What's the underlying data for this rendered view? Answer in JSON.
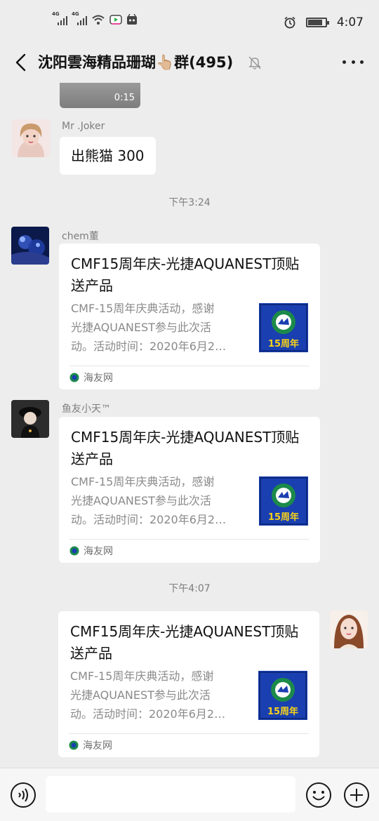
{
  "statusbar": {
    "network1": "4G",
    "network2": "4G",
    "time": "4:07",
    "battery_level": 0.85
  },
  "header": {
    "title": "沈阳雲海精品珊瑚👆🏼群(495)",
    "icons": [
      "back-arrow-icon",
      "mute-bell-icon",
      "more-icon"
    ]
  },
  "chat": {
    "video_duration": "0:15",
    "messages": [
      {
        "type": "text",
        "sender": "Mr .Joker",
        "text": "出熊猫 300"
      },
      {
        "type": "timestamp",
        "text": "下午3:24"
      },
      {
        "type": "card",
        "sender": "chem董",
        "title": "CMF15周年庆-光捷AQUANEST顶贴送产品",
        "desc": "CMF-15周年庆典活动，感谢\n光捷AQUANEST参与此次活\n动。活动时间：2020年6月2…",
        "thumb_label": "15周年",
        "source": "海友网"
      },
      {
        "type": "card",
        "sender": "鱼友小天™",
        "title": "CMF15周年庆-光捷AQUANEST顶贴送产品",
        "desc": "CMF-15周年庆典活动，感谢\n光捷AQUANEST参与此次活\n动。活动时间：2020年6月2…",
        "thumb_label": "15周年",
        "source": "海友网"
      },
      {
        "type": "timestamp",
        "text": "下午4:07"
      },
      {
        "type": "card",
        "sender": "",
        "title": "CMF15周年庆-光捷AQUANEST顶贴送产品",
        "desc": "CMF-15周年庆典活动，感谢\n光捷AQUANEST参与此次活\n动。活动时间：2020年6月2…",
        "thumb_label": "15周年",
        "source": "海友网"
      }
    ]
  },
  "inputbar": {
    "value": "",
    "icons": [
      "voice-icon",
      "emoji-icon",
      "plus-icon"
    ]
  },
  "colors": {
    "background": "#ededed",
    "bubble": "#ffffff",
    "meta_text": "#7d7d7d",
    "thumb_blue": "#1a3fb0",
    "thumb_green": "#1c8a4a"
  }
}
